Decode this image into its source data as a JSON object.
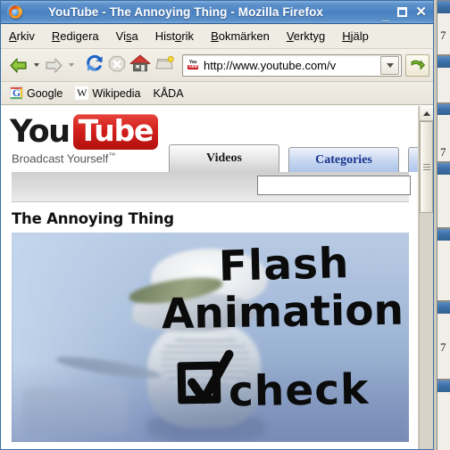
{
  "window": {
    "title": "YouTube - The Annoying Thing - Mozilla Firefox",
    "app_icon": "firefox-logo",
    "buttons": {
      "minimize": "_",
      "maximize": "□",
      "close": "✕"
    }
  },
  "menubar": {
    "items": [
      {
        "label": "Arkiv",
        "accel_index": 0
      },
      {
        "label": "Redigera",
        "accel_index": 0
      },
      {
        "label": "Visa",
        "accel_index": 2
      },
      {
        "label": "Historik",
        "accel_index": 4
      },
      {
        "label": "Bokmärken",
        "accel_index": 0
      },
      {
        "label": "Verktyg",
        "accel_index": 0
      },
      {
        "label": "Hjälp",
        "accel_index": 0
      }
    ]
  },
  "toolbar": {
    "back": "back-arrow",
    "back_dropdown": "chevron-down-icon",
    "forward": "forward-arrow",
    "forward_dropdown": "chevron-down-icon",
    "reload": "reload-icon",
    "stop": "stop-icon",
    "home": "home-icon",
    "bookmark_manager": "bookmark-icon",
    "url_value": "http://www.youtube.com/v",
    "url_favicon": "youtube-favicon",
    "url_favicon_you": "You",
    "url_favicon_tube": "Tube",
    "url_dropdown": "chevron-down-icon",
    "go": "go-arrow-icon"
  },
  "bookmarks_bar": {
    "items": [
      {
        "label": "Google",
        "favicon": "google-favicon",
        "favicon_glyph": "G"
      },
      {
        "label": "Wikipedia",
        "favicon": "wikipedia-favicon",
        "favicon_glyph": "W"
      },
      {
        "label": "KÅDA",
        "favicon": "none",
        "favicon_glyph": ""
      }
    ]
  },
  "page": {
    "logo": {
      "word_you": "You",
      "word_tube": "Tube",
      "slogan": "Broadcast Yourself",
      "slogan_tm": "™"
    },
    "tabs": [
      {
        "label": "Videos",
        "state": "active"
      },
      {
        "label": "Categories",
        "state": "inactive"
      },
      {
        "label": "",
        "state": "inactive"
      }
    ],
    "search_value": "",
    "search_placeholder": "",
    "video_title": "The Annoying Thing",
    "video_overlay": {
      "line1": "Flash",
      "line2": "Animation",
      "line3": "check",
      "checkbox": "checked-checkbox-drawing"
    }
  },
  "scrollbar": {
    "up_arrow": "scroll-up-icon",
    "thumb": "scroll-thumb"
  },
  "background": {
    "marks": [
      "7",
      "7",
      "7"
    ]
  },
  "colors": {
    "titlebar_blue": "#4a81c0",
    "youtube_red": "#cc181e",
    "tab_active_bg": "#e2e2e2",
    "tab_inactive_blue": "#aec6ea",
    "tab_inactive_text": "#17348c",
    "chrome_beige": "#efece4",
    "video_blue": "#a3b9d8",
    "ink_black": "#0b0b0b"
  }
}
